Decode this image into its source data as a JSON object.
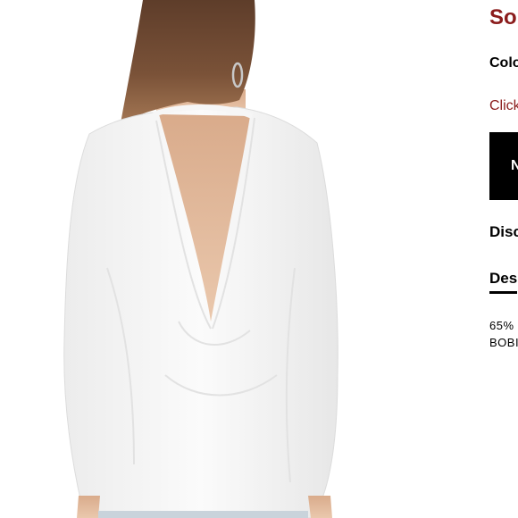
{
  "product": {
    "title_partial": "So",
    "color_label_partial": "Colo",
    "click_text_partial": "Click",
    "cta_partial": "N",
    "discount_label_partial": "Disc",
    "description_tab_partial": "Des",
    "fabric_partial": "65%",
    "brand_partial": "BOBI"
  },
  "colors": {
    "accent": "#8b1c1c",
    "cta_background": "#000000",
    "garment": "#ffffff",
    "hair": "#7a5238",
    "skin": "#e9c3a6"
  },
  "image": {
    "subject": "model-back-view-white-draped-top"
  }
}
